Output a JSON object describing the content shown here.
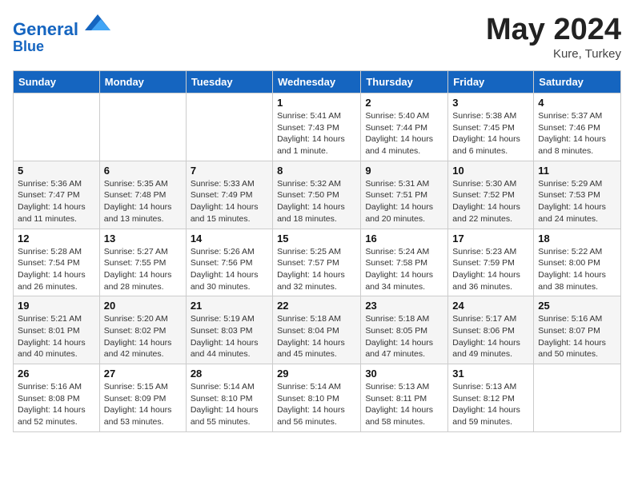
{
  "header": {
    "logo_line1": "General",
    "logo_line2": "Blue",
    "month_year": "May 2024",
    "location": "Kure, Turkey"
  },
  "days_of_week": [
    "Sunday",
    "Monday",
    "Tuesday",
    "Wednesday",
    "Thursday",
    "Friday",
    "Saturday"
  ],
  "weeks": [
    [
      {
        "day": "",
        "sunrise": "",
        "sunset": "",
        "daylight": ""
      },
      {
        "day": "",
        "sunrise": "",
        "sunset": "",
        "daylight": ""
      },
      {
        "day": "",
        "sunrise": "",
        "sunset": "",
        "daylight": ""
      },
      {
        "day": "1",
        "sunrise": "Sunrise: 5:41 AM",
        "sunset": "Sunset: 7:43 PM",
        "daylight": "Daylight: 14 hours and 1 minute."
      },
      {
        "day": "2",
        "sunrise": "Sunrise: 5:40 AM",
        "sunset": "Sunset: 7:44 PM",
        "daylight": "Daylight: 14 hours and 4 minutes."
      },
      {
        "day": "3",
        "sunrise": "Sunrise: 5:38 AM",
        "sunset": "Sunset: 7:45 PM",
        "daylight": "Daylight: 14 hours and 6 minutes."
      },
      {
        "day": "4",
        "sunrise": "Sunrise: 5:37 AM",
        "sunset": "Sunset: 7:46 PM",
        "daylight": "Daylight: 14 hours and 8 minutes."
      }
    ],
    [
      {
        "day": "5",
        "sunrise": "Sunrise: 5:36 AM",
        "sunset": "Sunset: 7:47 PM",
        "daylight": "Daylight: 14 hours and 11 minutes."
      },
      {
        "day": "6",
        "sunrise": "Sunrise: 5:35 AM",
        "sunset": "Sunset: 7:48 PM",
        "daylight": "Daylight: 14 hours and 13 minutes."
      },
      {
        "day": "7",
        "sunrise": "Sunrise: 5:33 AM",
        "sunset": "Sunset: 7:49 PM",
        "daylight": "Daylight: 14 hours and 15 minutes."
      },
      {
        "day": "8",
        "sunrise": "Sunrise: 5:32 AM",
        "sunset": "Sunset: 7:50 PM",
        "daylight": "Daylight: 14 hours and 18 minutes."
      },
      {
        "day": "9",
        "sunrise": "Sunrise: 5:31 AM",
        "sunset": "Sunset: 7:51 PM",
        "daylight": "Daylight: 14 hours and 20 minutes."
      },
      {
        "day": "10",
        "sunrise": "Sunrise: 5:30 AM",
        "sunset": "Sunset: 7:52 PM",
        "daylight": "Daylight: 14 hours and 22 minutes."
      },
      {
        "day": "11",
        "sunrise": "Sunrise: 5:29 AM",
        "sunset": "Sunset: 7:53 PM",
        "daylight": "Daylight: 14 hours and 24 minutes."
      }
    ],
    [
      {
        "day": "12",
        "sunrise": "Sunrise: 5:28 AM",
        "sunset": "Sunset: 7:54 PM",
        "daylight": "Daylight: 14 hours and 26 minutes."
      },
      {
        "day": "13",
        "sunrise": "Sunrise: 5:27 AM",
        "sunset": "Sunset: 7:55 PM",
        "daylight": "Daylight: 14 hours and 28 minutes."
      },
      {
        "day": "14",
        "sunrise": "Sunrise: 5:26 AM",
        "sunset": "Sunset: 7:56 PM",
        "daylight": "Daylight: 14 hours and 30 minutes."
      },
      {
        "day": "15",
        "sunrise": "Sunrise: 5:25 AM",
        "sunset": "Sunset: 7:57 PM",
        "daylight": "Daylight: 14 hours and 32 minutes."
      },
      {
        "day": "16",
        "sunrise": "Sunrise: 5:24 AM",
        "sunset": "Sunset: 7:58 PM",
        "daylight": "Daylight: 14 hours and 34 minutes."
      },
      {
        "day": "17",
        "sunrise": "Sunrise: 5:23 AM",
        "sunset": "Sunset: 7:59 PM",
        "daylight": "Daylight: 14 hours and 36 minutes."
      },
      {
        "day": "18",
        "sunrise": "Sunrise: 5:22 AM",
        "sunset": "Sunset: 8:00 PM",
        "daylight": "Daylight: 14 hours and 38 minutes."
      }
    ],
    [
      {
        "day": "19",
        "sunrise": "Sunrise: 5:21 AM",
        "sunset": "Sunset: 8:01 PM",
        "daylight": "Daylight: 14 hours and 40 minutes."
      },
      {
        "day": "20",
        "sunrise": "Sunrise: 5:20 AM",
        "sunset": "Sunset: 8:02 PM",
        "daylight": "Daylight: 14 hours and 42 minutes."
      },
      {
        "day": "21",
        "sunrise": "Sunrise: 5:19 AM",
        "sunset": "Sunset: 8:03 PM",
        "daylight": "Daylight: 14 hours and 44 minutes."
      },
      {
        "day": "22",
        "sunrise": "Sunrise: 5:18 AM",
        "sunset": "Sunset: 8:04 PM",
        "daylight": "Daylight: 14 hours and 45 minutes."
      },
      {
        "day": "23",
        "sunrise": "Sunrise: 5:18 AM",
        "sunset": "Sunset: 8:05 PM",
        "daylight": "Daylight: 14 hours and 47 minutes."
      },
      {
        "day": "24",
        "sunrise": "Sunrise: 5:17 AM",
        "sunset": "Sunset: 8:06 PM",
        "daylight": "Daylight: 14 hours and 49 minutes."
      },
      {
        "day": "25",
        "sunrise": "Sunrise: 5:16 AM",
        "sunset": "Sunset: 8:07 PM",
        "daylight": "Daylight: 14 hours and 50 minutes."
      }
    ],
    [
      {
        "day": "26",
        "sunrise": "Sunrise: 5:16 AM",
        "sunset": "Sunset: 8:08 PM",
        "daylight": "Daylight: 14 hours and 52 minutes."
      },
      {
        "day": "27",
        "sunrise": "Sunrise: 5:15 AM",
        "sunset": "Sunset: 8:09 PM",
        "daylight": "Daylight: 14 hours and 53 minutes."
      },
      {
        "day": "28",
        "sunrise": "Sunrise: 5:14 AM",
        "sunset": "Sunset: 8:10 PM",
        "daylight": "Daylight: 14 hours and 55 minutes."
      },
      {
        "day": "29",
        "sunrise": "Sunrise: 5:14 AM",
        "sunset": "Sunset: 8:10 PM",
        "daylight": "Daylight: 14 hours and 56 minutes."
      },
      {
        "day": "30",
        "sunrise": "Sunrise: 5:13 AM",
        "sunset": "Sunset: 8:11 PM",
        "daylight": "Daylight: 14 hours and 58 minutes."
      },
      {
        "day": "31",
        "sunrise": "Sunrise: 5:13 AM",
        "sunset": "Sunset: 8:12 PM",
        "daylight": "Daylight: 14 hours and 59 minutes."
      },
      {
        "day": "",
        "sunrise": "",
        "sunset": "",
        "daylight": ""
      }
    ]
  ]
}
